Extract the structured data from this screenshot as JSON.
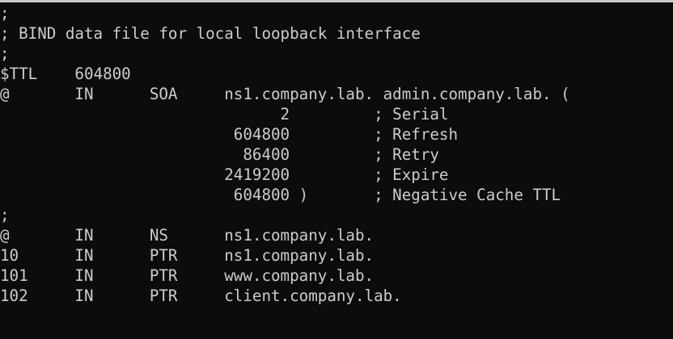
{
  "terminal": {
    "background": "#0c0c0c",
    "foreground": "#cccccc",
    "lines": [
      ";",
      "; BIND data file for local loopback interface",
      ";",
      "$TTL    604800",
      "@       IN      SOA     ns1.company.lab. admin.company.lab. (",
      "                              2         ; Serial",
      "                         604800         ; Refresh",
      "                          86400         ; Retry",
      "                        2419200         ; Expire",
      "                         604800 )       ; Negative Cache TTL",
      ";",
      "@       IN      NS      ns1.company.lab.",
      "10      IN      PTR     ns1.company.lab.",
      "101     IN      PTR     www.company.lab.",
      "102     IN      PTR     client.company.lab."
    ]
  }
}
